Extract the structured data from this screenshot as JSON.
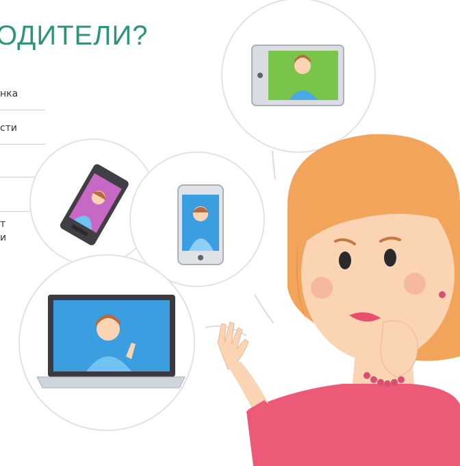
{
  "title": "ОДИТЕЛИ?",
  "list": [
    "нка",
    "сти",
    "т",
    "и"
  ],
  "colors": {
    "title": "#2e9478",
    "hair": "#f2a45b",
    "skin": "#fbd4b4",
    "shirt": "#ec5a78",
    "screen_green": "#79c44a",
    "screen_blue": "#3a9ee0",
    "screen_pink": "#c768c4"
  },
  "illustration": {
    "bubbles": [
      "tablet-video-call",
      "phone-video-call",
      "smartphone-video-call",
      "laptop-video-call"
    ],
    "character": "worried-mother"
  }
}
